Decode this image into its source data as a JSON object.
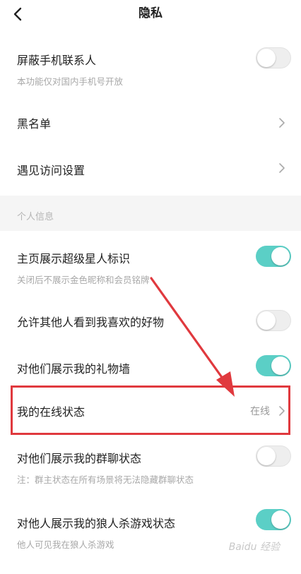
{
  "header": {
    "title": "隐私"
  },
  "items": {
    "block_contacts": {
      "label": "屏蔽手机联系人",
      "sub": "本功能仅对国内手机号开放",
      "toggle": false
    },
    "blacklist": {
      "label": "黑名单"
    },
    "visit_settings": {
      "label": "遇见访问设置"
    }
  },
  "section": {
    "title": "个人信息"
  },
  "personal": {
    "superstar": {
      "label": "主页展示超级星人标识",
      "sub": "关闭后不展示金色昵称和会员铭牌",
      "toggle": true
    },
    "favorites": {
      "label": "允许其他人看到我喜欢的好物",
      "toggle": false
    },
    "gift_wall": {
      "label": "对他们展示我的礼物墙",
      "toggle": true
    },
    "online_status": {
      "label": "我的在线状态",
      "value": "在线"
    },
    "group_chat": {
      "label": "对他们展示我的群聊状态",
      "sub": "注：群主状态在所有场景将无法隐藏群聊状态",
      "toggle": false
    },
    "werewolf": {
      "label": "对他人展示我的狼人杀游戏状态",
      "sub": "他人可见我在狼人杀游戏",
      "toggle": true
    }
  },
  "colors": {
    "accent": "#5bcfc6",
    "highlight": "#e0393e"
  },
  "watermark": "Baidu 经验"
}
